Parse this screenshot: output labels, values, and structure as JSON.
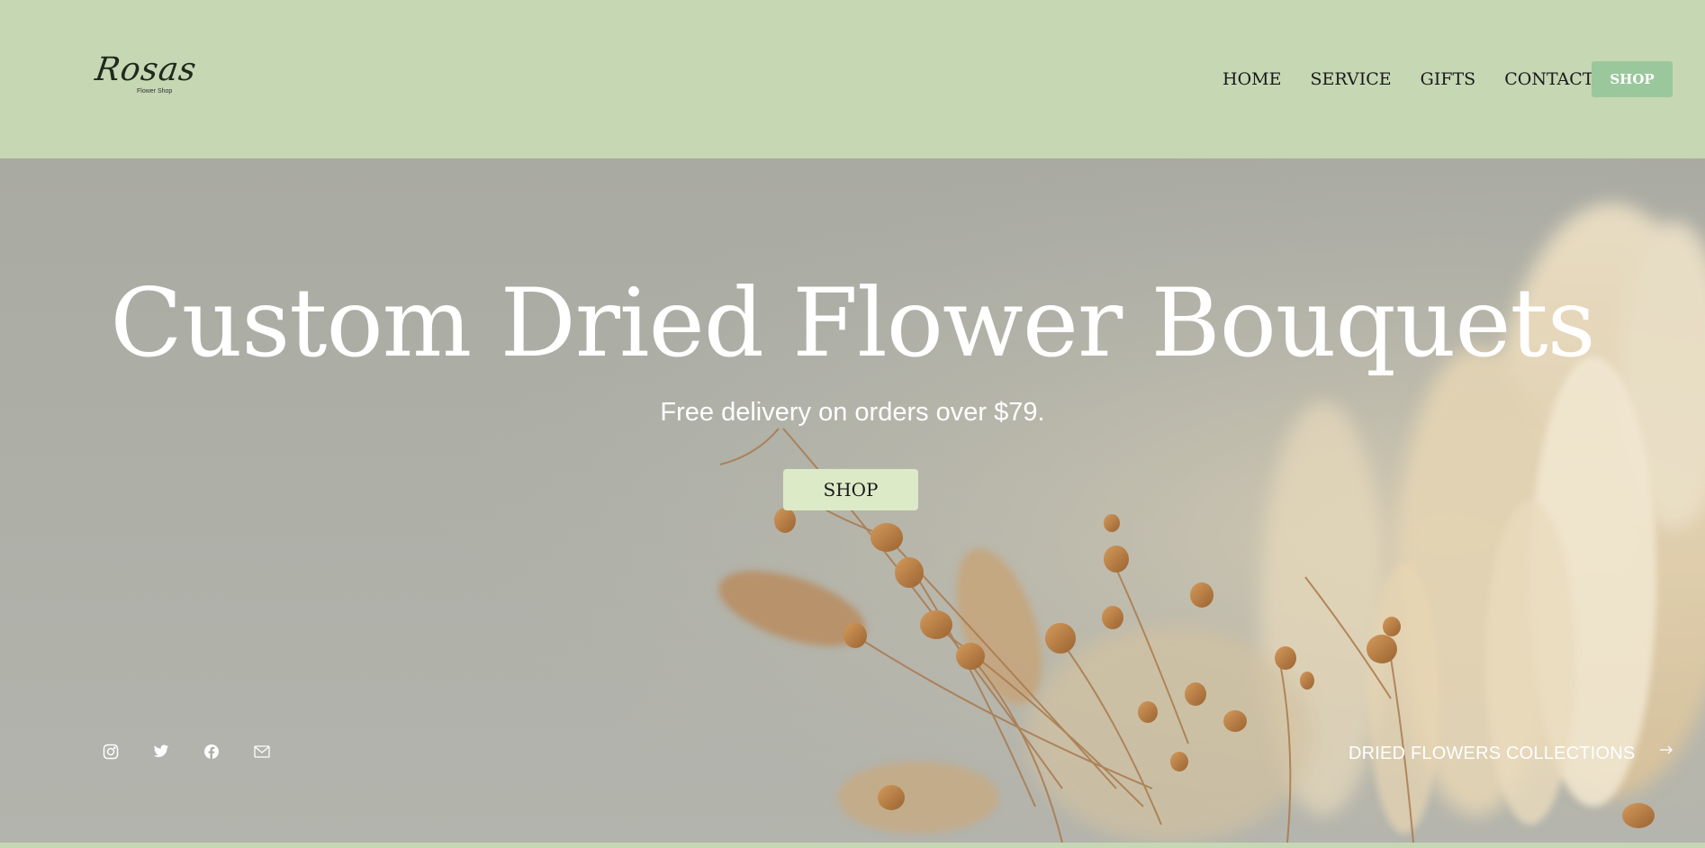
{
  "brand": {
    "name": "Rosas",
    "tagline": "Flower Shop"
  },
  "nav": {
    "items": [
      "HOME",
      "SERVICE",
      "GIFTS",
      "CONTACT"
    ],
    "shop_label": "SHOP"
  },
  "hero": {
    "title": "Custom Dried Flower Bouquets",
    "subtitle": "Free delivery on orders over $79.",
    "shop_label": "SHOP",
    "collections_label": "DRIED FLOWERS COLLECTIONS"
  },
  "social": {
    "icons": [
      "instagram-icon",
      "twitter-icon",
      "facebook-icon",
      "mail-icon"
    ]
  },
  "colors": {
    "header_bg": "#c5d7b3",
    "nav_shop_bg": "#9bc79c",
    "hero_shop_bg": "#dceac7",
    "hero_text": "#ffffff"
  }
}
